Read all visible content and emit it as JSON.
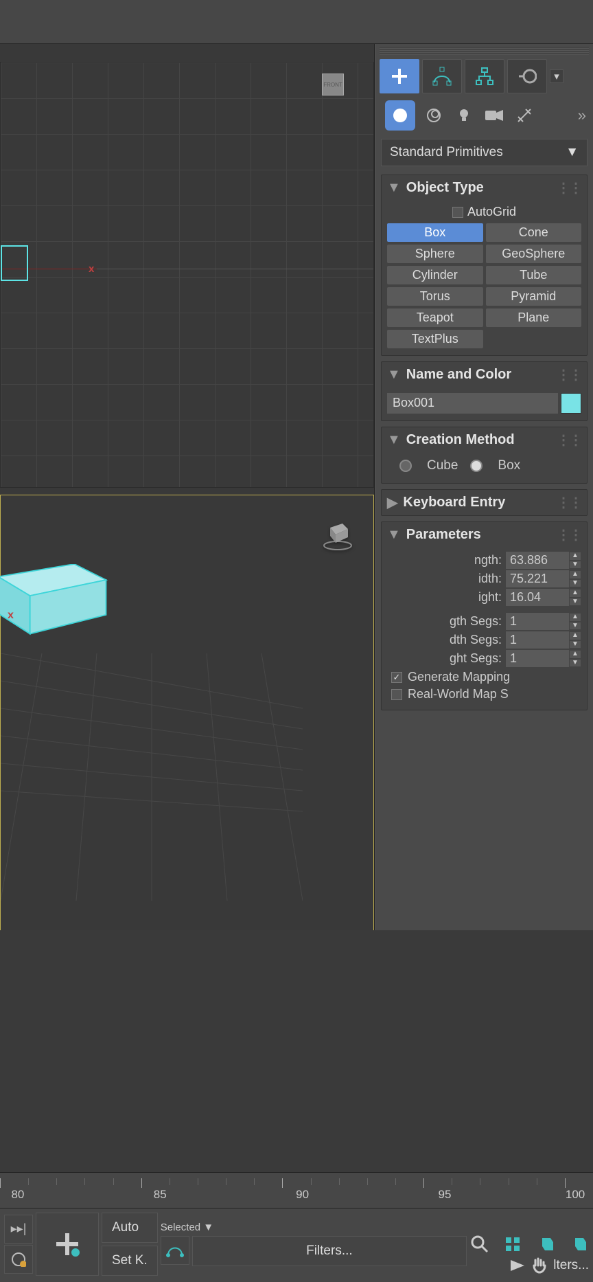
{
  "command_panel": {
    "dropdown": "Standard Primitives",
    "object_type": {
      "title": "Object Type",
      "autogrid": "AutoGrid",
      "buttons": [
        "Box",
        "Cone",
        "Sphere",
        "GeoSphere",
        "Cylinder",
        "Tube",
        "Torus",
        "Pyramid",
        "Teapot",
        "Plane",
        "TextPlus"
      ],
      "selected": "Box"
    },
    "name_color": {
      "title": "Name and Color",
      "name": "Box001",
      "color": "#79e3e6"
    },
    "creation_method": {
      "title": "Creation Method",
      "options": [
        "Cube",
        "Box"
      ],
      "selected": "Box"
    },
    "keyboard_entry": {
      "title": "Keyboard Entry"
    },
    "parameters": {
      "title": "Parameters",
      "length": {
        "label": "ngth:",
        "value": "63.886"
      },
      "width": {
        "label": "idth:",
        "value": "75.221"
      },
      "height": {
        "label": "ight:",
        "value": "16.04"
      },
      "lsegs": {
        "label": "gth Segs:",
        "value": "1"
      },
      "wsegs": {
        "label": "dth Segs:",
        "value": "1"
      },
      "hsegs": {
        "label": "ght Segs:",
        "value": "1"
      },
      "gen_mapping": "Generate Mapping",
      "real_world": "Real-World Map S"
    }
  },
  "viewport": {
    "front_label": "FRONT",
    "x": "x"
  },
  "timeline": {
    "labels": [
      "80",
      "85",
      "90",
      "95",
      "100"
    ]
  },
  "controls": {
    "auto": "Auto",
    "setkey": "Set K.",
    "selected": "Selected",
    "filters": "Filters...",
    "filters2": "lters..."
  }
}
